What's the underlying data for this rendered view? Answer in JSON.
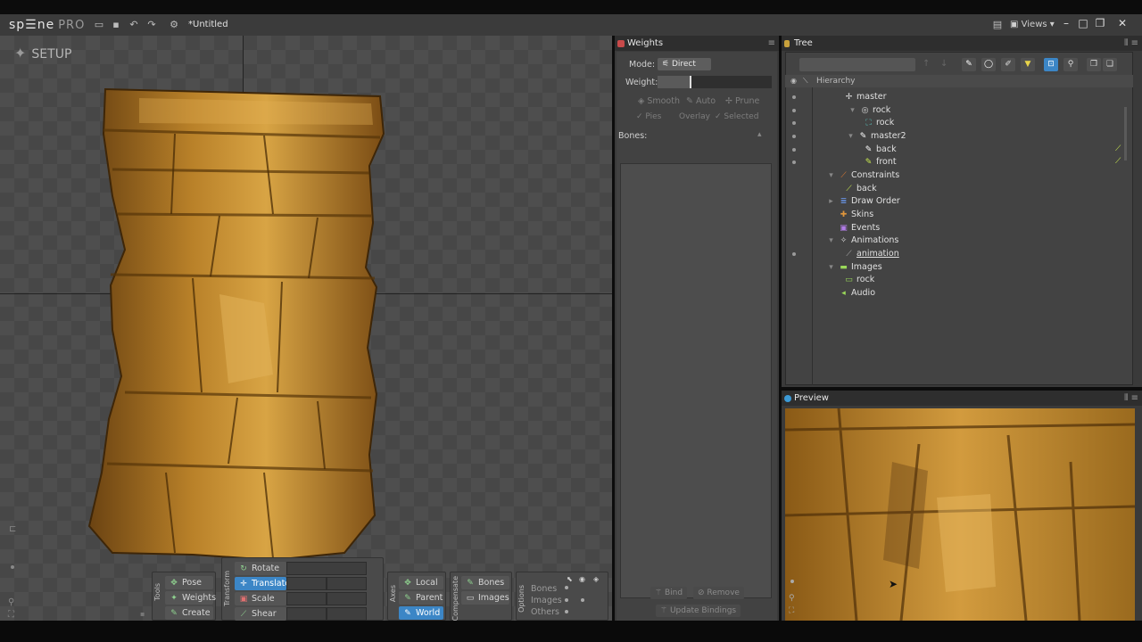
{
  "app": {
    "logo": "sp☰ne",
    "edition": "PRO",
    "filename": "*Untitled",
    "views_label": "Views"
  },
  "viewport": {
    "mode_label": "SETUP"
  },
  "tools": {
    "group_label": "Tools",
    "pose": "Pose",
    "weights": "Weights",
    "create": "Create"
  },
  "transform": {
    "group_label": "Transform",
    "rotate": "Rotate",
    "translate": "Translate",
    "scale": "Scale",
    "shear": "Shear"
  },
  "axes": {
    "group_label": "Axes",
    "local": "Local",
    "parent": "Parent",
    "world": "World"
  },
  "compensate": {
    "group_label": "Compensate",
    "bones": "Bones",
    "images": "Images"
  },
  "options": {
    "group_label": "Options",
    "bones": "Bones",
    "images": "Images",
    "others": "Others"
  },
  "weights_panel": {
    "title": "Weights",
    "mode_label": "Mode:",
    "mode_value": "Direct",
    "weight_label": "Weight:",
    "smooth": "Smooth",
    "auto": "Auto",
    "prune": "Prune",
    "pies": "Pies",
    "overlay": "Overlay",
    "selected": "Selected",
    "bones_label": "Bones:",
    "bind": "Bind",
    "remove": "Remove",
    "update_bindings": "Update Bindings"
  },
  "tree_panel": {
    "title": "Tree",
    "hierarchy": "Hierarchy",
    "items": [
      {
        "label": "master"
      },
      {
        "label": "rock"
      },
      {
        "label": "rock"
      },
      {
        "label": "master2"
      },
      {
        "label": "back"
      },
      {
        "label": "front"
      },
      {
        "label": "Constraints"
      },
      {
        "label": "back"
      },
      {
        "label": "Draw Order"
      },
      {
        "label": "Skins"
      },
      {
        "label": "Events"
      },
      {
        "label": "Animations"
      },
      {
        "label": "animation"
      },
      {
        "label": "Images"
      },
      {
        "label": "rock"
      },
      {
        "label": "Audio"
      }
    ]
  },
  "preview_panel": {
    "title": "Preview"
  },
  "colors": {
    "accent": "#3c86c6",
    "rock": "#b07a26",
    "key": "#c8e84f"
  }
}
